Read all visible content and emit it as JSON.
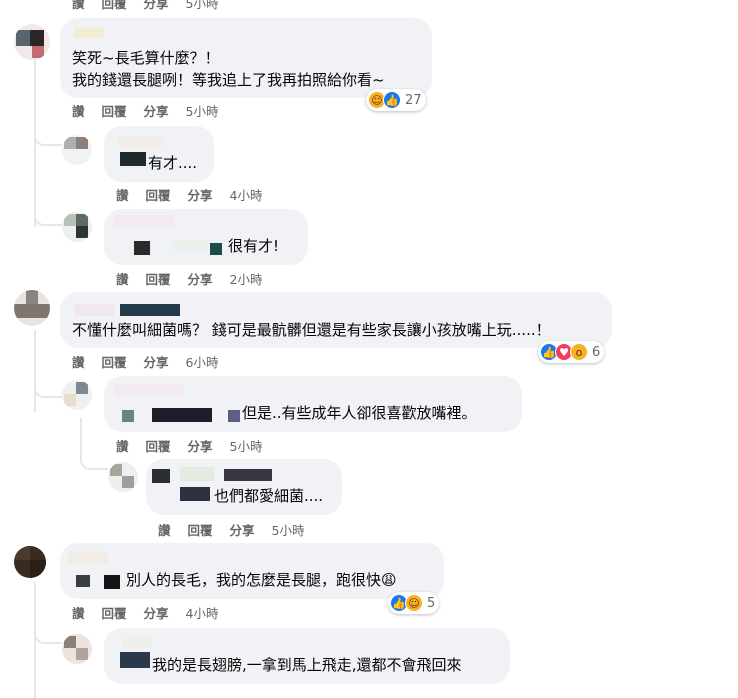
{
  "comments": [
    {
      "id": "c1",
      "text_lines": [
        "笑死~長毛算什麼？！",
        "我的錢還長腿咧！等我追上了我再拍照給你看~"
      ],
      "actions": {
        "like": "讚",
        "reply": "回覆",
        "share": "分享",
        "time": "5小時"
      },
      "reactions": {
        "icons": [
          "haha-icon",
          "like-icon"
        ],
        "count": "27"
      }
    },
    {
      "id": "r1",
      "text": "有才....",
      "actions": {
        "like": "讚",
        "reply": "回覆",
        "share": "分享",
        "time": "4小時"
      }
    },
    {
      "id": "r2",
      "text": "很有才!",
      "actions": {
        "like": "讚",
        "reply": "回覆",
        "share": "分享",
        "time": "2小時"
      }
    },
    {
      "id": "c2",
      "text": "不懂什麼叫細菌嗎？ 錢可是最骯髒但還是有些家長讓小孩放嘴上玩.....！",
      "actions": {
        "like": "讚",
        "reply": "回覆",
        "share": "分享",
        "time": "6小時"
      },
      "reactions": {
        "icons": [
          "like-icon",
          "love-icon",
          "wow-icon"
        ],
        "count": "6"
      }
    },
    {
      "id": "r3",
      "text": "但是..有些成年人卻很喜歡放嘴裡。",
      "actions": {
        "like": "讚",
        "reply": "回覆",
        "share": "分享",
        "time": "5小時"
      }
    },
    {
      "id": "r4",
      "text": "也們都愛細菌....",
      "actions": {
        "like": "讚",
        "reply": "回覆",
        "share": "分享",
        "time": "5小時"
      }
    },
    {
      "id": "c3",
      "text": "別人的長毛，我的怎麼是長腿，跑很快😩",
      "actions": {
        "like": "讚",
        "reply": "回覆",
        "share": "分享",
        "time": "4小時"
      },
      "reactions": {
        "icons": [
          "like-icon",
          "haha-icon"
        ],
        "count": "5"
      }
    },
    {
      "id": "r5",
      "text": "我的是長翅膀,一拿到馬上飛走,還都不會飛回來"
    }
  ],
  "top_partial": {
    "like": "讚",
    "reply": "回覆",
    "share": "分享",
    "time": "5小時"
  }
}
